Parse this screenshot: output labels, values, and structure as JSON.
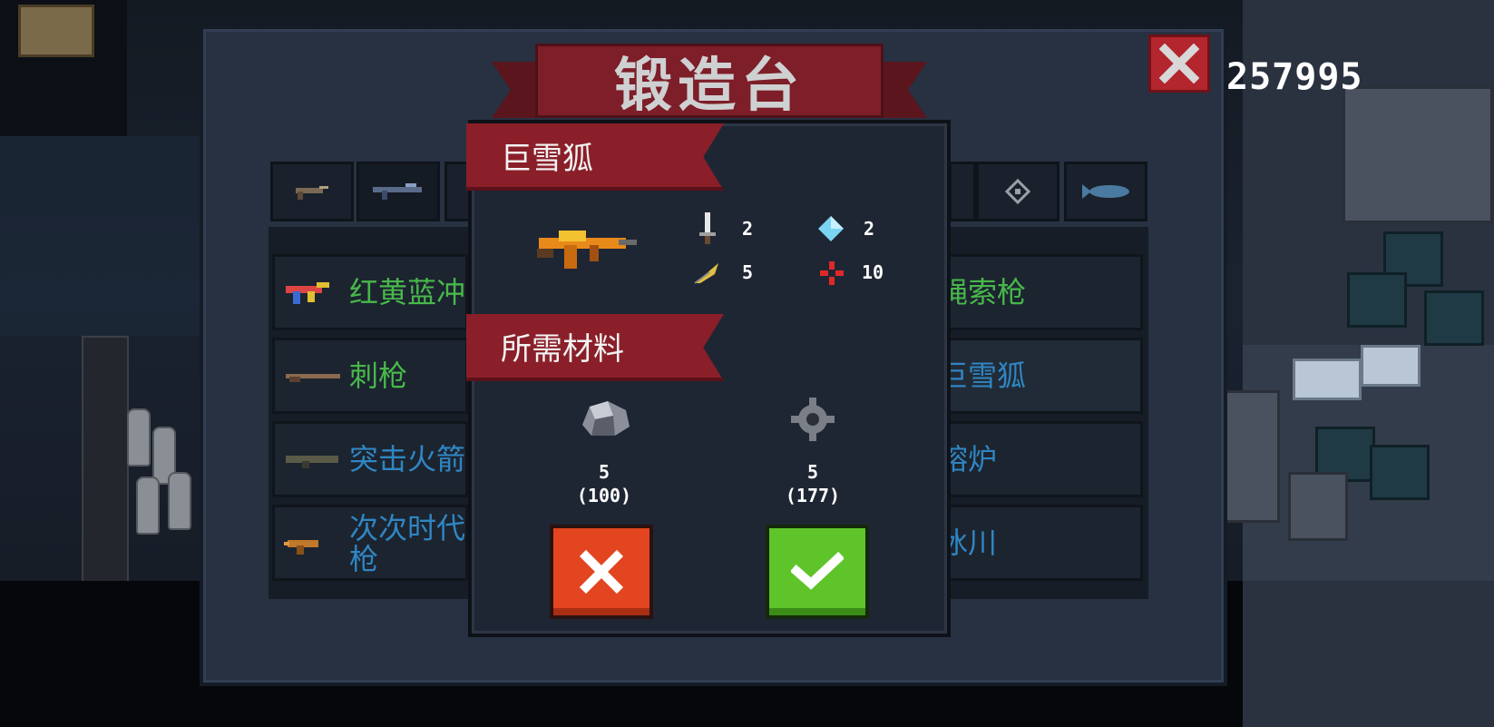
{
  "header": {
    "title": "锻造台",
    "coins": "257995"
  },
  "weapon_list": {
    "left_rows": [
      {
        "label": "红黄蓝冲",
        "color": "#48b84a"
      },
      {
        "label": "刺枪",
        "color": "#48b84a"
      },
      {
        "label": "突击火箭",
        "color": "#2f86c2"
      },
      {
        "label": "次次时代\n枪",
        "color": "#2f86c2"
      }
    ],
    "right_rows": [
      {
        "label": "绳索枪",
        "color": "#48b84a"
      },
      {
        "label": "巨雪狐",
        "color": "#2f86c2"
      },
      {
        "label": "熔炉",
        "color": "#2f86c2"
      },
      {
        "label": "冰川",
        "color": "#2f86c2"
      }
    ]
  },
  "detail": {
    "weapon_name": "巨雪狐",
    "stats": [
      {
        "icon": "sword-icon",
        "value": "2"
      },
      {
        "icon": "diamond-icon",
        "value": "2"
      },
      {
        "icon": "feather-icon",
        "value": "5"
      },
      {
        "icon": "crosshair-icon",
        "value": "10"
      }
    ],
    "materials_title": "所需材料",
    "materials": [
      {
        "icon": "ore-icon",
        "required": "5",
        "owned": "(100)"
      },
      {
        "icon": "gear-part-icon",
        "required": "5",
        "owned": "(177)"
      }
    ]
  },
  "colors": {
    "panel": "#273141",
    "ribbon": "#8a1f29",
    "cancel": "#e2451f",
    "confirm": "#5ec42a"
  }
}
